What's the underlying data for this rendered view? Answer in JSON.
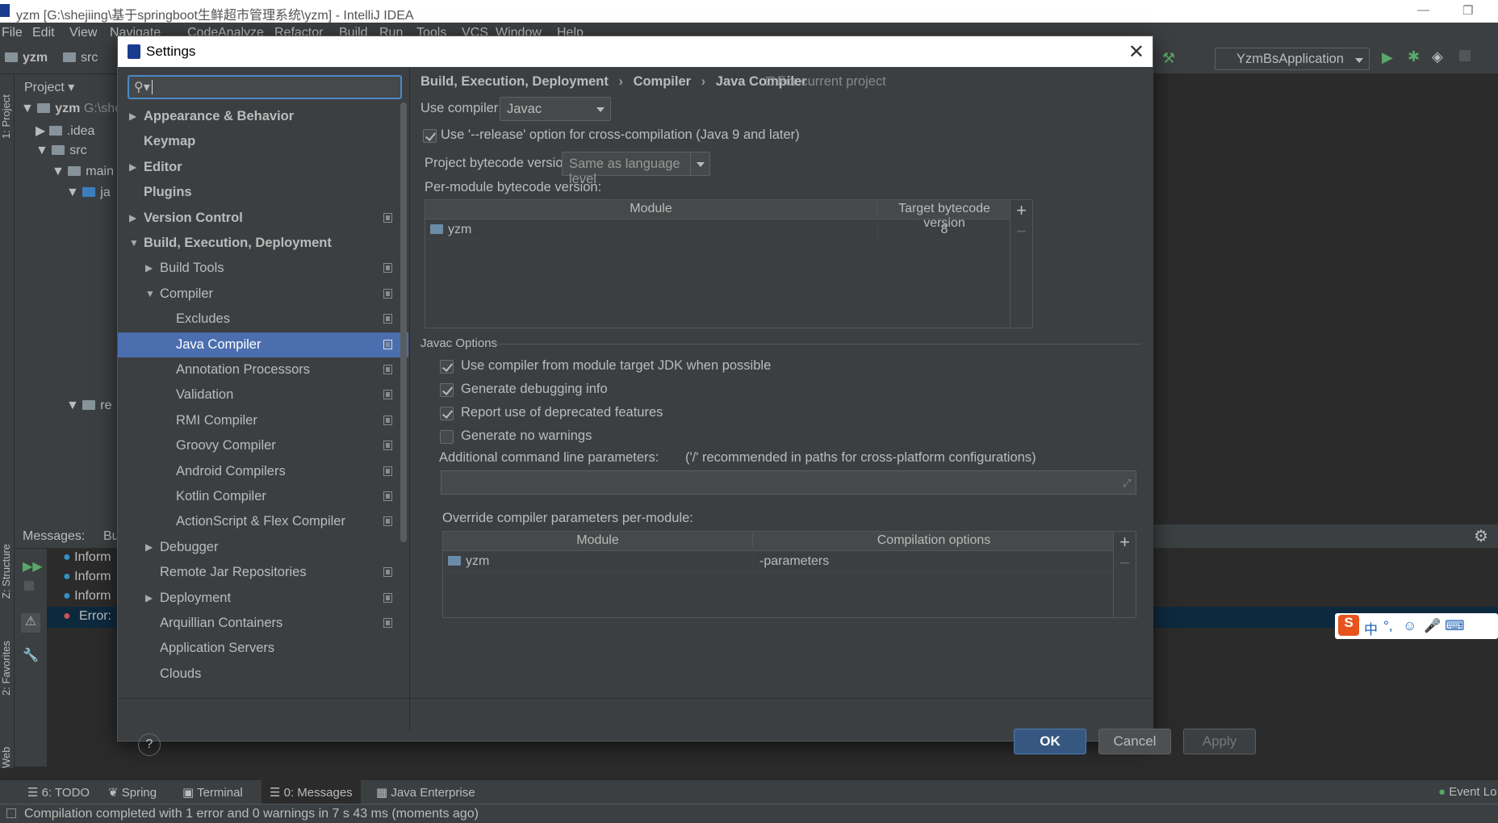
{
  "window": {
    "title": "yzm [G:\\shejiing\\基于springboot生鲜超市管理系统\\yzm] - IntelliJ IDEA"
  },
  "menu": [
    "File",
    "Edit",
    "View",
    "Navigate",
    "Code",
    "Analyze",
    "Refactor",
    "Build",
    "Run",
    "Tools",
    "VCS",
    "Window",
    "Help"
  ],
  "navbar": {
    "crumbs": [
      "yzm",
      "src"
    ],
    "run_config": "YzmBsApplication"
  },
  "project_panel": {
    "title": "Project",
    "items": [
      {
        "label": "yzm",
        "path": "G:\\she"
      },
      {
        "label": ".idea"
      },
      {
        "label": "src"
      },
      {
        "label": "main"
      },
      {
        "label": "ja"
      },
      {
        "label": "re"
      }
    ]
  },
  "left_strip": {
    "project": "1: Project",
    "structure": "Z: Structure",
    "favorites": "2: Favorites",
    "web": "Web"
  },
  "messages": {
    "tab_label": "Messages:",
    "tab2": "Bu",
    "rows": [
      {
        "kind": "info",
        "text": "Inform"
      },
      {
        "kind": "info",
        "text": "Inform"
      },
      {
        "kind": "info",
        "text": "Inform"
      },
      {
        "kind": "error",
        "text": "Error:"
      }
    ]
  },
  "ime_bar": {
    "glyph": "中",
    "punct": "°,"
  },
  "bottom_tabs": [
    {
      "label": "6: TODO"
    },
    {
      "label": "Spring"
    },
    {
      "label": "Terminal"
    },
    {
      "label": "0: Messages"
    },
    {
      "label": "Java Enterprise"
    }
  ],
  "event_log": "Event Lo",
  "status_text": "Compilation completed with 1 error and 0 warnings in 7 s 43 ms (moments ago)",
  "dialog": {
    "title": "Settings",
    "tree": [
      {
        "label": "Appearance & Behavior",
        "bold": true,
        "arrow": "right",
        "indent": 0,
        "page": false
      },
      {
        "label": "Keymap",
        "bold": true,
        "arrow": "",
        "indent": 0,
        "page": false
      },
      {
        "label": "Editor",
        "bold": true,
        "arrow": "right",
        "indent": 0,
        "page": false
      },
      {
        "label": "Plugins",
        "bold": true,
        "arrow": "",
        "indent": 0,
        "page": false
      },
      {
        "label": "Version Control",
        "bold": true,
        "arrow": "right",
        "indent": 0,
        "page": true
      },
      {
        "label": "Build, Execution, Deployment",
        "bold": true,
        "arrow": "down",
        "indent": 0,
        "page": false
      },
      {
        "label": "Build Tools",
        "bold": false,
        "arrow": "right",
        "indent": 1,
        "page": true
      },
      {
        "label": "Compiler",
        "bold": false,
        "arrow": "down",
        "indent": 1,
        "page": true
      },
      {
        "label": "Excludes",
        "bold": false,
        "arrow": "",
        "indent": 2,
        "page": true
      },
      {
        "label": "Java Compiler",
        "bold": false,
        "arrow": "",
        "indent": 2,
        "page": true,
        "selected": true
      },
      {
        "label": "Annotation Processors",
        "bold": false,
        "arrow": "",
        "indent": 2,
        "page": true
      },
      {
        "label": "Validation",
        "bold": false,
        "arrow": "",
        "indent": 2,
        "page": true
      },
      {
        "label": "RMI Compiler",
        "bold": false,
        "arrow": "",
        "indent": 2,
        "page": true
      },
      {
        "label": "Groovy Compiler",
        "bold": false,
        "arrow": "",
        "indent": 2,
        "page": true
      },
      {
        "label": "Android Compilers",
        "bold": false,
        "arrow": "",
        "indent": 2,
        "page": true
      },
      {
        "label": "Kotlin Compiler",
        "bold": false,
        "arrow": "",
        "indent": 2,
        "page": true
      },
      {
        "label": "ActionScript & Flex Compiler",
        "bold": false,
        "arrow": "",
        "indent": 2,
        "page": true
      },
      {
        "label": "Debugger",
        "bold": false,
        "arrow": "right",
        "indent": 1,
        "page": false
      },
      {
        "label": "Remote Jar Repositories",
        "bold": false,
        "arrow": "",
        "indent": 1,
        "page": true
      },
      {
        "label": "Deployment",
        "bold": false,
        "arrow": "right",
        "indent": 1,
        "page": true
      },
      {
        "label": "Arquillian Containers",
        "bold": false,
        "arrow": "",
        "indent": 1,
        "page": true
      },
      {
        "label": "Application Servers",
        "bold": false,
        "arrow": "",
        "indent": 1,
        "page": false
      },
      {
        "label": "Clouds",
        "bold": false,
        "arrow": "",
        "indent": 1,
        "page": false
      }
    ],
    "breadcrumb": [
      "Build, Execution, Deployment",
      "Compiler",
      "Java Compiler"
    ],
    "scope_note": "For current project",
    "use_compiler_label": "Use compiler:",
    "use_compiler_value": "Javac",
    "release_option": {
      "label": "Use '--release' option for cross-compilation (Java 9 and later)",
      "checked": true
    },
    "project_bytecode_label": "Project bytecode version:",
    "project_bytecode_value": "Same as language level",
    "per_module_label": "Per-module bytecode version:",
    "bytecode_table": {
      "headers": [
        "Module",
        "Target bytecode version"
      ],
      "rows": [
        {
          "module": "yzm",
          "version": "8"
        }
      ]
    },
    "javac_options_title": "Javac Options",
    "options": [
      {
        "label": "Use compiler from module target JDK when possible",
        "checked": true
      },
      {
        "label": "Generate debugging info",
        "checked": true
      },
      {
        "label": "Report use of deprecated features",
        "checked": true
      },
      {
        "label": "Generate no warnings",
        "checked": false
      }
    ],
    "additional_params_label": "Additional command line parameters:",
    "additional_params_hint": "('/' recommended in paths for cross-platform configurations)",
    "additional_params_value": "",
    "override_label": "Override compiler parameters per-module:",
    "override_table": {
      "headers": [
        "Module",
        "Compilation options"
      ],
      "rows": [
        {
          "module": "yzm",
          "options": "-parameters"
        }
      ]
    },
    "buttons": {
      "ok": "OK",
      "cancel": "Cancel",
      "apply": "Apply",
      "help": "?"
    }
  }
}
